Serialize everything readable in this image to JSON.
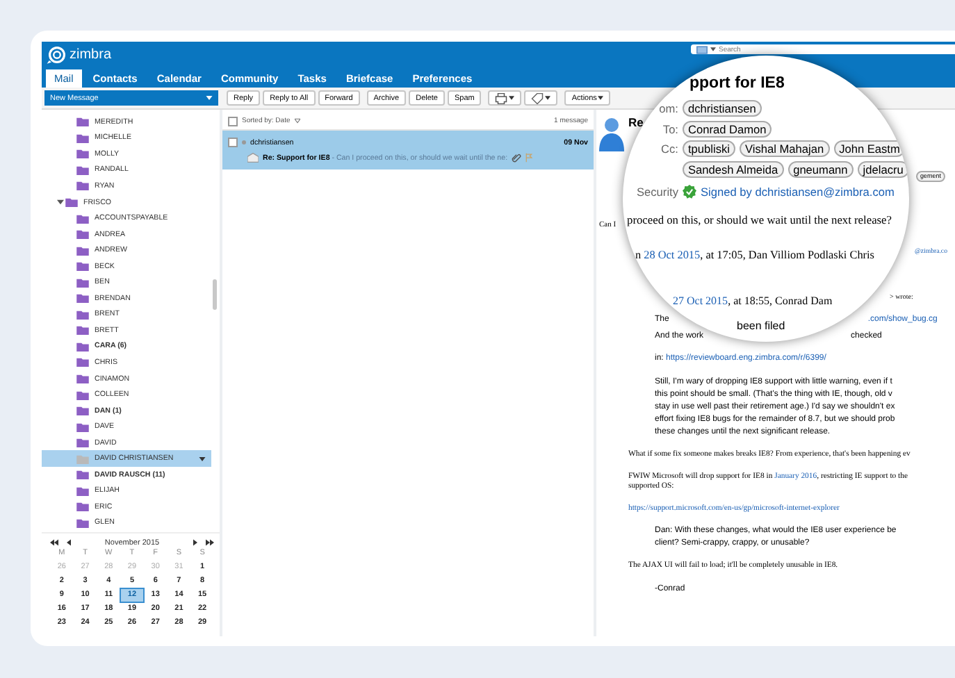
{
  "header": {
    "logo": "zimbra",
    "search": {
      "placeholder": "Search"
    }
  },
  "tabs": [
    {
      "label": "Mail",
      "selected": true
    },
    {
      "label": "Contacts",
      "selected": false
    },
    {
      "label": "Calendar",
      "selected": false
    },
    {
      "label": "Community",
      "selected": false
    },
    {
      "label": "Tasks",
      "selected": false
    },
    {
      "label": "Briefcase",
      "selected": false
    },
    {
      "label": "Preferences",
      "selected": false
    }
  ],
  "toolbar": {
    "new_message": "New Message",
    "buttons": [
      {
        "kind": "text",
        "label": "Reply"
      },
      {
        "kind": "text",
        "label": "Reply to All"
      },
      {
        "kind": "text",
        "label": "Forward"
      },
      {
        "kind": "text",
        "label": "Archive"
      },
      {
        "kind": "text",
        "label": "Delete"
      },
      {
        "kind": "text",
        "label": "Spam"
      },
      {
        "kind": "print"
      },
      {
        "kind": "tag"
      },
      {
        "kind": "menu",
        "label": "Actions"
      }
    ]
  },
  "folders": [
    {
      "label": "MEREDITH",
      "unread": false,
      "selected": false
    },
    {
      "label": "MICHELLE",
      "unread": false,
      "selected": false
    },
    {
      "label": "MOLLY",
      "unread": false,
      "selected": false
    },
    {
      "label": "RANDALL",
      "unread": false,
      "selected": false
    },
    {
      "label": "RYAN",
      "unread": false,
      "selected": false
    },
    {
      "label": "FRISCO",
      "unread": false,
      "selected": false,
      "expanded": true,
      "children": [
        {
          "label": "ACCOUNTSPAYABLE",
          "unread": false,
          "selected": false
        },
        {
          "label": "ANDREA",
          "unread": false,
          "selected": false
        },
        {
          "label": "ANDREW",
          "unread": false,
          "selected": false
        },
        {
          "label": "BECK",
          "unread": false,
          "selected": false
        },
        {
          "label": "BEN",
          "unread": false,
          "selected": false
        },
        {
          "label": "BRENDAN",
          "unread": false,
          "selected": false
        },
        {
          "label": "BRENT",
          "unread": false,
          "selected": false
        },
        {
          "label": "BRETT",
          "unread": false,
          "selected": false
        },
        {
          "label": "CARA (6)",
          "unread": true,
          "selected": false
        },
        {
          "label": "CHRIS",
          "unread": false,
          "selected": false
        },
        {
          "label": "CINAMON",
          "unread": false,
          "selected": false
        },
        {
          "label": "COLLEEN",
          "unread": false,
          "selected": false
        },
        {
          "label": "DAN (1)",
          "unread": true,
          "selected": false
        },
        {
          "label": "DAVE",
          "unread": false,
          "selected": false
        },
        {
          "label": "DAVID",
          "unread": false,
          "selected": false
        },
        {
          "label": "DAVID CHRISTIANSEN",
          "unread": false,
          "selected": true
        },
        {
          "label": "DAVID RAUSCH (11)",
          "unread": true,
          "selected": false
        },
        {
          "label": "ELIJAH",
          "unread": false,
          "selected": false
        },
        {
          "label": "ERIC",
          "unread": false,
          "selected": false
        },
        {
          "label": "GLEN",
          "unread": false,
          "selected": false
        }
      ]
    }
  ],
  "calendar": {
    "title": "November 2015",
    "weekdays": [
      "M",
      "T",
      "W",
      "T",
      "F",
      "S",
      "S"
    ],
    "weeks": [
      [
        {
          "day": "26",
          "other_month": true,
          "selected": false
        },
        {
          "day": "27",
          "other_month": true,
          "selected": false
        },
        {
          "day": "28",
          "other_month": true,
          "selected": false
        },
        {
          "day": "29",
          "other_month": true,
          "selected": false
        },
        {
          "day": "30",
          "other_month": true,
          "selected": false
        },
        {
          "day": "31",
          "other_month": true,
          "selected": false
        },
        {
          "day": "1",
          "other_month": false,
          "selected": false
        }
      ],
      [
        {
          "day": "2",
          "other_month": false,
          "selected": false
        },
        {
          "day": "3",
          "other_month": false,
          "selected": false
        },
        {
          "day": "4",
          "other_month": false,
          "selected": false
        },
        {
          "day": "5",
          "other_month": false,
          "selected": false
        },
        {
          "day": "6",
          "other_month": false,
          "selected": false
        },
        {
          "day": "7",
          "other_month": false,
          "selected": false
        },
        {
          "day": "8",
          "other_month": false,
          "selected": false
        }
      ],
      [
        {
          "day": "9",
          "other_month": false,
          "selected": false
        },
        {
          "day": "10",
          "other_month": false,
          "selected": false
        },
        {
          "day": "11",
          "other_month": false,
          "selected": false
        },
        {
          "day": "12",
          "other_month": false,
          "selected": true
        },
        {
          "day": "13",
          "other_month": false,
          "selected": false
        },
        {
          "day": "14",
          "other_month": false,
          "selected": false
        },
        {
          "day": "15",
          "other_month": false,
          "selected": false
        }
      ],
      [
        {
          "day": "16",
          "other_month": false,
          "selected": false
        },
        {
          "day": "17",
          "other_month": false,
          "selected": false
        },
        {
          "day": "18",
          "other_month": false,
          "selected": false
        },
        {
          "day": "19",
          "other_month": false,
          "selected": false
        },
        {
          "day": "20",
          "other_month": false,
          "selected": false
        },
        {
          "day": "21",
          "other_month": false,
          "selected": false
        },
        {
          "day": "22",
          "other_month": false,
          "selected": false
        }
      ],
      [
        {
          "day": "23",
          "other_month": false,
          "selected": false
        },
        {
          "day": "24",
          "other_month": false,
          "selected": false
        },
        {
          "day": "25",
          "other_month": false,
          "selected": false
        },
        {
          "day": "26",
          "other_month": false,
          "selected": false
        },
        {
          "day": "27",
          "other_month": false,
          "selected": false
        },
        {
          "day": "28",
          "other_month": false,
          "selected": false
        },
        {
          "day": "29",
          "other_month": false,
          "selected": false
        }
      ]
    ]
  },
  "message_list": {
    "select_all": {
      "checked": false
    },
    "sort_label": "Sorted by: Date",
    "count": "1 message",
    "messages": [
      {
        "sender": "dchristiansen",
        "date": "09 Nov",
        "subject": "Re: Support for IE8",
        "fragment": " - Can I proceed on this, or should we wait until the ne:",
        "selected": true,
        "checked": false,
        "has_attachment": true
      }
    ]
  },
  "reading_pane": {
    "subject_start": "Re",
    "lead": "Can I",
    "email_tail": "@zimbra.co",
    "wrote": "> wrote:",
    "the": "The",
    "bug_link": ".com/show_bug.cg",
    "work_start": "And the work",
    "work_end": "checked",
    "blocks": [
      {
        "kind": "quote",
        "lines": [
          [
            {
              "text": "in: "
            },
            {
              "text": "https://reviewboard.eng.zimbra.com/r/6399/",
              "link": true
            }
          ]
        ]
      },
      {
        "kind": "quote",
        "lines": [
          [
            {
              "text": "Still, I'm wary of dropping IE8 support with little warning, even if t"
            }
          ],
          [
            {
              "text": "this point should be small. (That's the thing with IE, though, old v"
            }
          ],
          [
            {
              "text": "stay in use well past their retirement age.) I'd say we shouldn't ex"
            }
          ],
          [
            {
              "text": "effort fixing IE8 bugs for the remainder of 8.7, but we should prob"
            }
          ],
          [
            {
              "text": "these changes until the next significant release."
            }
          ]
        ]
      },
      {
        "kind": "plain",
        "lines": [
          [
            {
              "text": "What if some fix someone makes breaks IE8? From experience, that's been happening ev"
            }
          ]
        ]
      },
      {
        "kind": "plain",
        "lines": [
          [
            {
              "text": "FWIW Microsoft will drop support for IE8 in "
            },
            {
              "text": "January 2016",
              "link": true
            },
            {
              "text": ", restricting IE support to the"
            }
          ],
          [
            {
              "text": "supported OS:"
            }
          ]
        ]
      },
      {
        "kind": "plain",
        "lines": [
          [
            {
              "text": "https://support.microsoft.com/en-us/gp/microsoft-internet-explorer",
              "link": true
            }
          ]
        ]
      },
      {
        "kind": "quote",
        "lines": [
          [
            {
              "text": "Dan: With these changes, what would the IE8 user experience be"
            }
          ],
          [
            {
              "text": "client? Semi-crappy, crappy, or unusable?"
            }
          ]
        ]
      },
      {
        "kind": "plain",
        "lines": [
          [
            {
              "text": "The AJAX UI will fail to load; it'll be completely unusable in IE8."
            }
          ]
        ]
      },
      {
        "kind": "quote",
        "lines": [
          [
            {
              "text": "-Conrad"
            }
          ]
        ]
      }
    ],
    "lens": {
      "subject": "pport for IE8",
      "from_label": "om:",
      "from": [
        "dchristiansen"
      ],
      "to_label": "To:",
      "to": [
        "Conrad Damon"
      ],
      "cc_label": "Cc:",
      "cc_rows": [
        [
          "tpubliski",
          "Vishal Mahajan",
          "John Eastm"
        ],
        [
          "Sandesh Almeida",
          "gneumann",
          "jdelacru"
        ]
      ],
      "cc_overflow": "gement",
      "security_label": "Security",
      "signed": "Signed by dchristiansen@zimbra.com",
      "body": "proceed on this, or should we wait until the next release?",
      "attribution_start": "n ",
      "attribution_date": "28 Oct 2015",
      "attribution_rest": ", at 17:05, Dan Villiom Podlaski Chris",
      "inner_date": "27 Oct 2015",
      "inner_rest": ", at 18:55, Conrad Dam",
      "filed": "been filed"
    }
  }
}
